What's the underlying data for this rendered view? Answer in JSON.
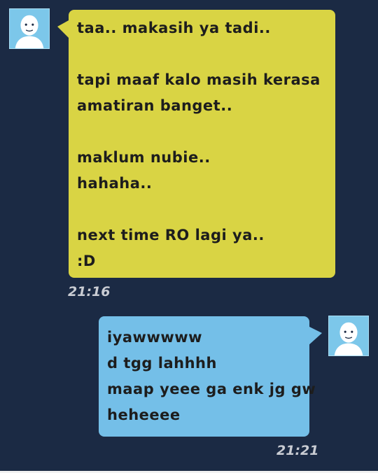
{
  "messages": [
    {
      "direction": "incoming",
      "lines": [
        "taa.. makasih ya tadi..",
        "",
        "tapi maaf kalo masih kerasa",
        "amatiran banget..",
        "",
        "maklum nubie..",
        "hahaha..",
        "",
        "next time RO lagi ya..",
        ":D"
      ],
      "time": "21:16",
      "bubble_color": "#d9d444"
    },
    {
      "direction": "outgoing",
      "lines": [
        "iyawwwww",
        "d tgg lahhhh",
        "maap yeee ga enk jg gw",
        "heheeee"
      ],
      "time": "21:21",
      "bubble_color": "#74bfe8"
    }
  ],
  "colors": {
    "background": "#1b2a44",
    "timestamp": "#c9ccd3",
    "avatar": "#7cc7ea"
  },
  "icons": {
    "avatar": "default-user-avatar-icon"
  }
}
